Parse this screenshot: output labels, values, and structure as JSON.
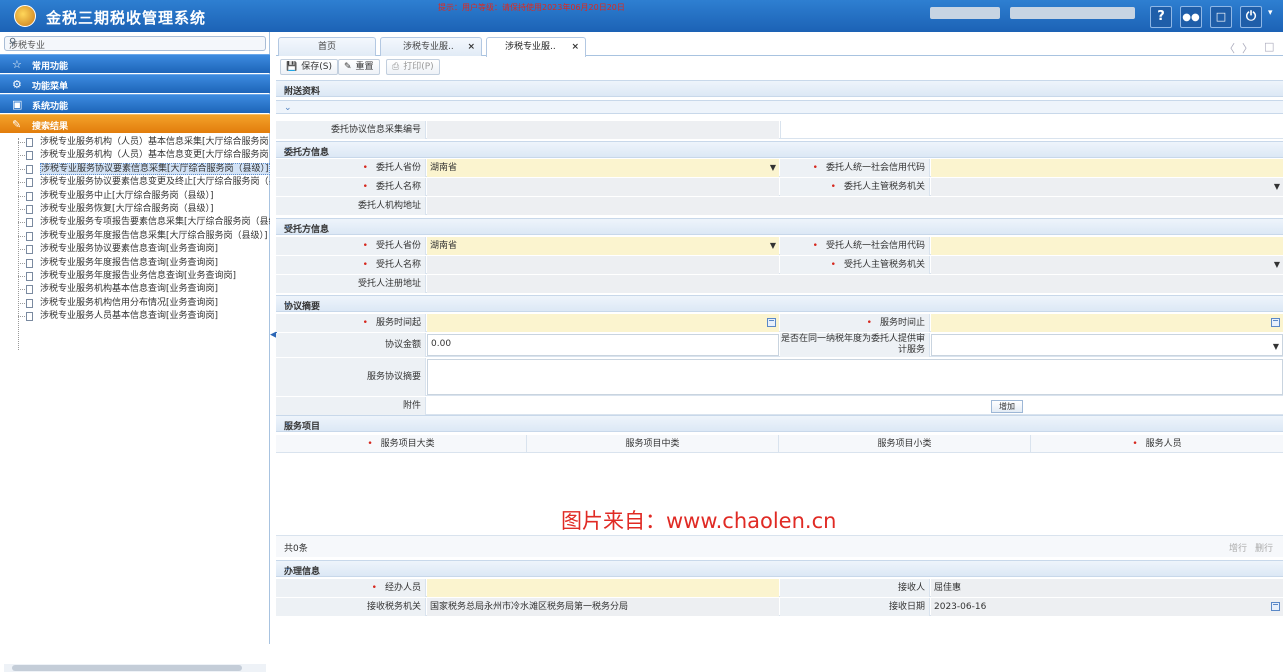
{
  "app": {
    "title": "金税三期税收管理系统",
    "notice": "提示：用户等级：请保持使用2023年06月20日20日"
  },
  "topbar": {
    "help_icon": "question-icon",
    "users_icon": "users-icon",
    "chat_icon": "chat-icon",
    "power_icon": "power-icon"
  },
  "sidebar": {
    "search_placeholder": "涉税专业",
    "sections": [
      {
        "label": "常用功能",
        "icon": "star-icon"
      },
      {
        "label": "功能菜单",
        "icon": "gear-icon"
      },
      {
        "label": "系统功能",
        "icon": "monitor-icon"
      },
      {
        "label": "搜索结果",
        "icon": "search-result-icon"
      }
    ],
    "items": [
      "涉税专业服务机构（人员）基本信息采集[大厅综合服务岗（",
      "涉税专业服务机构（人员）基本信息变更[大厅综合服务岗（",
      "涉税专业服务协议要素信息采集[大厅综合服务岗（县级）]",
      "涉税专业服务协议要素信息变更及终止[大厅综合服务岗（县",
      "涉税专业服务中止[大厅综合服务岗（县级）]",
      "涉税专业服务恢复[大厅综合服务岗（县级）]",
      "涉税专业服务专项报告要素信息采集[大厅综合服务岗（县级",
      "涉税专业服务年度报告信息采集[大厅综合服务岗（县级）]",
      "涉税专业服务协议要素信息查询[业务查询岗]",
      "涉税专业服务年度报告信息查询[业务查询岗]",
      "涉税专业服务年度报告业务信息查询[业务查询岗]",
      "涉税专业服务机构基本信息查询[业务查询岗]",
      "涉税专业服务机构信用分布情况[业务查询岗]",
      "涉税专业服务人员基本信息查询[业务查询岗]"
    ]
  },
  "tabs": [
    {
      "label": "首页"
    },
    {
      "label": "涉税专业服..",
      "close": "×"
    },
    {
      "label": "涉税专业服..",
      "close": "×"
    }
  ],
  "toolbar": {
    "save": "保存(S)",
    "reset": "重置",
    "print": "打印(P)"
  },
  "sections": {
    "attach": "附送资料",
    "client": "委托方信息",
    "trustee": "受托方信息",
    "agreement": "协议摘要",
    "service": "服务项目",
    "handle": "办理信息"
  },
  "form": {
    "agreement_no_label": "委托协议信息采集编号",
    "client_province_label": "委托人省份",
    "client_province_value": "湖南省",
    "client_credit_label": "委托人统一社会信用代码",
    "client_name_label": "委托人名称",
    "client_tax_office_label": "委托人主管税务机关",
    "client_address_label": "委托人机构地址",
    "trustee_province_label": "受托人省份",
    "trustee_province_value": "湖南省",
    "trustee_credit_label": "受托人统一社会信用代码",
    "trustee_name_label": "受托人名称",
    "trustee_tax_office_label": "受托人主管税务机关",
    "trustee_address_label": "受托人注册地址",
    "service_start_label": "服务时间起",
    "service_end_label": "服务时间止",
    "amount_label": "协议金额",
    "amount_value": "0.00",
    "audit_label": "是否在同一纳税年度为委托人提供审计服务",
    "summary_label": "服务协议摘要",
    "attach_label": "附件",
    "attach_button": "增加"
  },
  "service_grid": {
    "columns": [
      "服务项目大类",
      "服务项目中类",
      "服务项目小类",
      "服务人员"
    ],
    "total": "共0条",
    "add_row": "增行",
    "del_row": "删行"
  },
  "handle": {
    "operator_label": "经办人员",
    "receiver_label": "接收人",
    "receiver_value": "屈佳惠",
    "office_label": "接收税务机关",
    "office_value": "国家税务总局永州市冷水滩区税务局第一税务分局",
    "date_label": "接收日期",
    "date_value": "2023-06-16"
  },
  "watermark": "图片来自：www.chaolen.cn"
}
